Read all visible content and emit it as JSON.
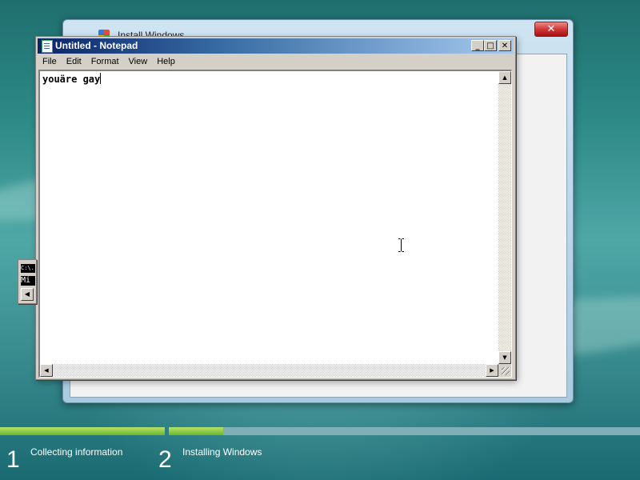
{
  "background_window": {
    "title": "Install Windows",
    "close_label": "✕"
  },
  "notepad": {
    "title": "Untitled - Notepad",
    "caption_buttons": {
      "minimize": "_",
      "maximize": "□",
      "close": "✕"
    },
    "menu": [
      "File",
      "Edit",
      "Format",
      "View",
      "Help"
    ],
    "content": "youäre gay"
  },
  "cmd_fragment": {
    "icon_text": "C:\\.",
    "text": "Mi"
  },
  "setup_steps": [
    {
      "number": "1",
      "label": "Collecting information",
      "progress": 1.0
    },
    {
      "number": "2",
      "label": "Installing Windows",
      "progress": 0.115
    }
  ],
  "colors": {
    "progress_fill": "#6bb82b",
    "titlebar_start": "#0a246a",
    "titlebar_end": "#a6caf0"
  }
}
